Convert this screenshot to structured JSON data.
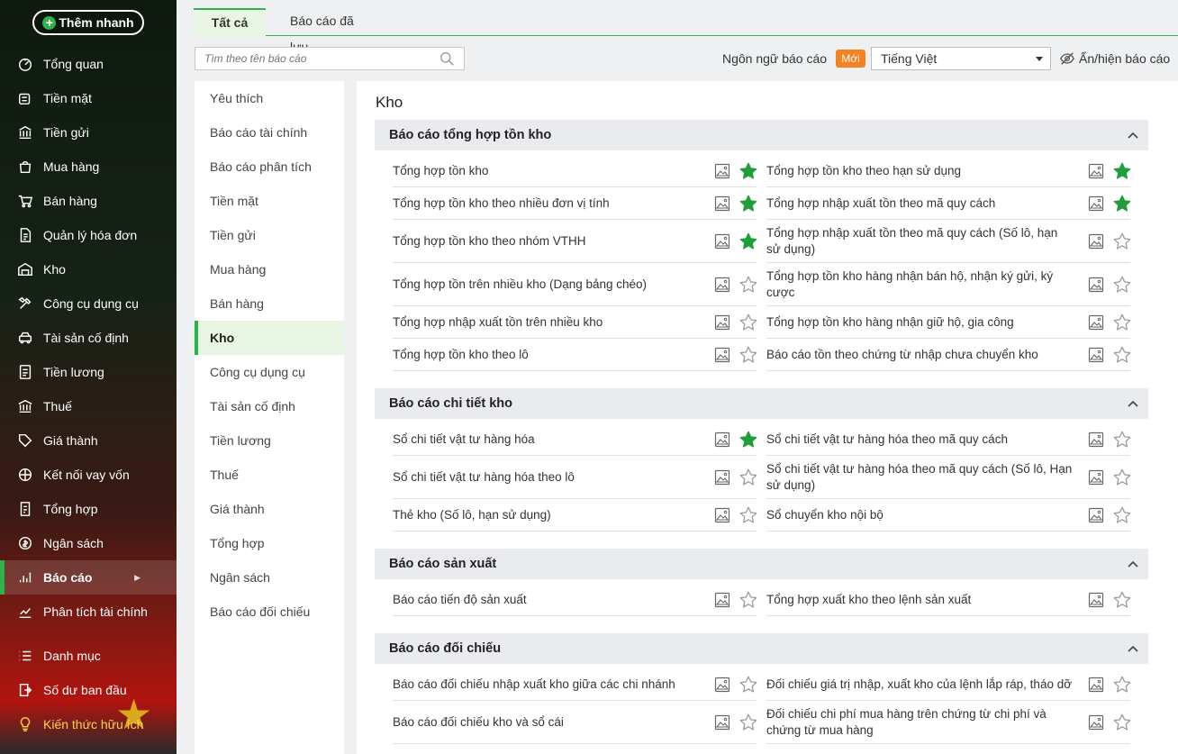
{
  "sidebar": {
    "quick_add": "Thêm nhanh",
    "items": [
      {
        "label": "Tổng quan",
        "icon": "dashboard-icon"
      },
      {
        "label": "Tiền mặt",
        "icon": "cash-icon"
      },
      {
        "label": "Tiền gửi",
        "icon": "bank-icon"
      },
      {
        "label": "Mua hàng",
        "icon": "shopping-bag-icon"
      },
      {
        "label": "Bán hàng",
        "icon": "cart-icon"
      },
      {
        "label": "Quản lý hóa đơn",
        "icon": "invoice-icon"
      },
      {
        "label": "Kho",
        "icon": "warehouse-icon"
      },
      {
        "label": "Công cụ dụng cụ",
        "icon": "tools-icon"
      },
      {
        "label": "Tài sản cố định",
        "icon": "car-icon"
      },
      {
        "label": "Tiền lương",
        "icon": "salary-icon"
      },
      {
        "label": "Thuế",
        "icon": "tax-icon"
      },
      {
        "label": "Giá thành",
        "icon": "price-tag-icon"
      },
      {
        "label": "Kết nối vay vốn",
        "icon": "loan-icon"
      },
      {
        "label": "Tổng hợp",
        "icon": "summary-icon"
      },
      {
        "label": "Ngân sách",
        "icon": "budget-icon"
      },
      {
        "label": "Báo cáo",
        "icon": "report-chart-icon",
        "active": true
      },
      {
        "label": "Phân tích tài chính",
        "icon": "analytics-icon"
      },
      {
        "label": "Danh mục",
        "icon": "list-icon"
      },
      {
        "label": "Số dư ban đầu",
        "icon": "opening-balance-icon"
      },
      {
        "label": "Kiến thức hữu ích",
        "icon": "knowledge-icon"
      }
    ]
  },
  "tabs": {
    "all": "Tất cả",
    "saved": "Báo cáo đã lưu"
  },
  "toolbar": {
    "search_placeholder": "Tìm theo tên báo cáo",
    "language_label": "Ngôn ngữ báo cáo",
    "new_badge": "Mới",
    "language_value": "Tiếng Việt",
    "toggle_label": "Ẩn/hiện báo cáo"
  },
  "categories": [
    "Yêu thích",
    "Báo cáo tài chính",
    "Báo cáo phân tích",
    "Tiền mặt",
    "Tiền gửi",
    "Mua hàng",
    "Bán hàng",
    "Kho",
    "Công cụ dụng cụ",
    "Tài sản cố định",
    "Tiền lương",
    "Thuế",
    "Giá thành",
    "Tổng hợp",
    "Ngân sách",
    "Báo cáo đối chiếu"
  ],
  "active_category": "Kho",
  "main": {
    "title": "Kho",
    "groups": [
      {
        "title": "Báo cáo tổng hợp tồn kho",
        "items": [
          {
            "label": "Tổng hợp tồn kho",
            "fav": true
          },
          {
            "label": "Tổng hợp tồn kho theo hạn sử dụng",
            "fav": true
          },
          {
            "label": "Tổng hợp tồn kho theo nhiều đơn vị tính",
            "fav": true
          },
          {
            "label": "Tổng hợp nhập xuất tồn theo mã quy cách",
            "fav": true
          },
          {
            "label": "Tổng hợp tồn kho theo nhóm VTHH",
            "fav": true
          },
          {
            "label": "Tổng hợp nhập xuất tồn theo mã quy cách (Số lô, hạn sử dụng)",
            "fav": false
          },
          {
            "label": "Tổng hợp tồn trên nhiều kho (Dạng bảng chéo)",
            "fav": false
          },
          {
            "label": "Tổng hợp tồn kho hàng nhận bán hộ, nhận ký gửi, ký cược",
            "fav": false
          },
          {
            "label": "Tổng hợp nhập xuất tồn trên nhiều kho",
            "fav": false
          },
          {
            "label": "Tổng hợp tồn kho hàng nhận giữ hộ, gia công",
            "fav": false
          },
          {
            "label": "Tổng hợp tồn kho theo lô",
            "fav": false
          },
          {
            "label": "Báo cáo tồn theo chứng từ nhập chưa chuyển kho",
            "fav": false
          }
        ]
      },
      {
        "title": "Báo cáo chi tiết kho",
        "items": [
          {
            "label": "Sổ chi tiết vật tư hàng hóa",
            "fav": true
          },
          {
            "label": "Sổ chi tiết vật tư hàng hóa theo mã quy cách",
            "fav": false
          },
          {
            "label": "Sổ chi tiết vật tư hàng hóa theo lô",
            "fav": false
          },
          {
            "label": "Sổ chi tiết vật tư hàng hóa theo mã quy cách (Số lô, Hạn sử dụng)",
            "fav": false
          },
          {
            "label": "Thẻ kho (Số lô, hạn sử dụng)",
            "fav": false
          },
          {
            "label": "Sổ chuyển kho nội bộ",
            "fav": false
          }
        ]
      },
      {
        "title": "Báo cáo sản xuất",
        "items": [
          {
            "label": "Báo cáo tiến độ sản xuất",
            "fav": false
          },
          {
            "label": "Tổng hợp xuất kho theo lệnh sản xuất",
            "fav": false
          }
        ]
      },
      {
        "title": "Báo cáo đối chiếu",
        "items": [
          {
            "label": "Báo cáo đối chiếu nhập xuất kho giữa các chi nhánh",
            "fav": false
          },
          {
            "label": "Đối chiếu giá trị nhập, xuất kho của lệnh lắp ráp, tháo dỡ",
            "fav": false
          },
          {
            "label": "Báo cáo đối chiếu kho và sổ cái",
            "fav": false
          },
          {
            "label": "Đối chiếu chi phí mua hàng trên chứng từ chi phí và chứng từ mua hàng",
            "fav": false
          }
        ]
      }
    ]
  },
  "colors": {
    "accent": "#2db34a",
    "badge": "#f58220",
    "star_filled": "#1f9e3a",
    "star_empty": "#9a9a9a"
  }
}
